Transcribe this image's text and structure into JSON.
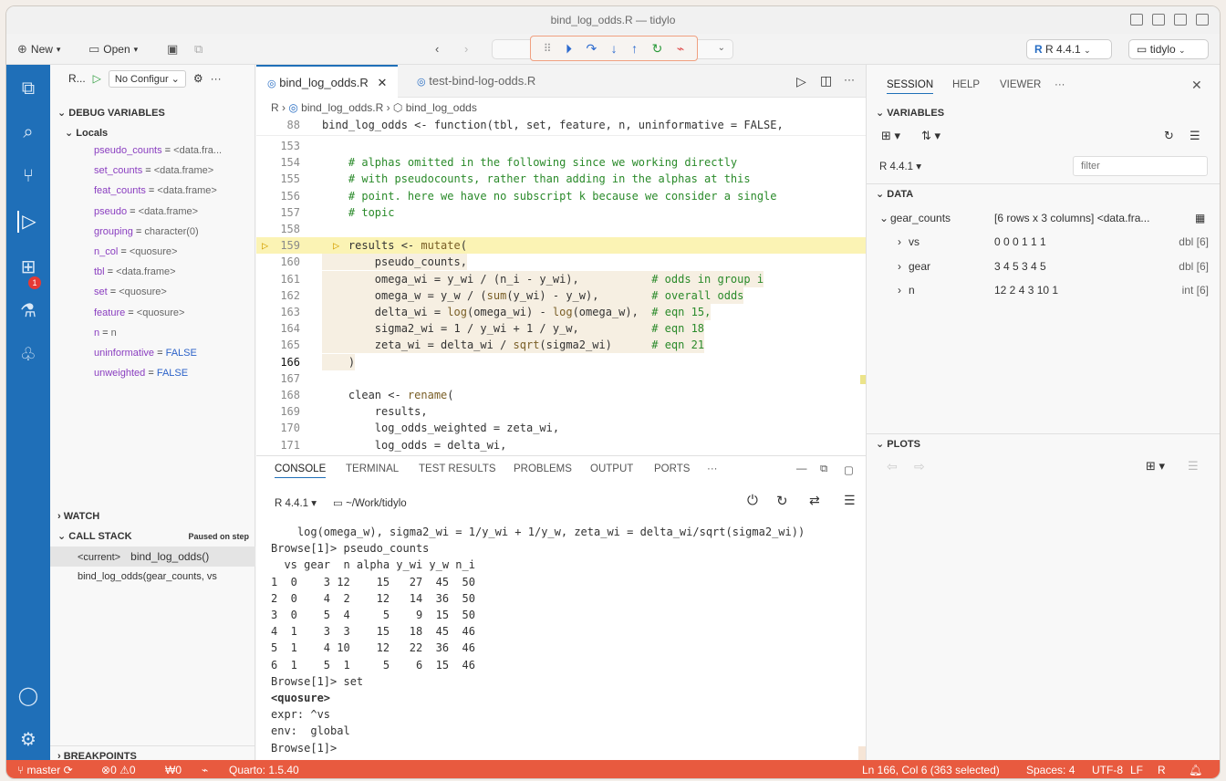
{
  "window_title": "bind_log_odds.R — tidylo",
  "toolbar": {
    "new_label": "New",
    "open_label": "Open",
    "r_version": "R 4.4.1",
    "project": "tidylo"
  },
  "sidebar": {
    "header_label": "R...",
    "config": "No Configur",
    "debug_variables_title": "DEBUG VARIABLES",
    "locals_title": "Locals",
    "variables": [
      {
        "name": "pseudo_counts",
        "value": "<data.fra..."
      },
      {
        "name": "set_counts",
        "value": "<data.frame>"
      },
      {
        "name": "feat_counts",
        "value": "<data.frame>"
      },
      {
        "name": "pseudo",
        "value": "<data.frame>"
      },
      {
        "name": "grouping",
        "value": "character(0)"
      },
      {
        "name": "n_col",
        "value": "<quosure>"
      },
      {
        "name": "tbl",
        "value": "<data.frame>"
      },
      {
        "name": "set",
        "value": "<quosure>"
      },
      {
        "name": "feature",
        "value": "<quosure>"
      },
      {
        "name": "n",
        "value": "n"
      },
      {
        "name": "uninformative",
        "value": "FALSE"
      },
      {
        "name": "unweighted",
        "value": "FALSE"
      }
    ],
    "watch_title": "WATCH",
    "callstack_title": "CALL STACK",
    "callstack_status": "Paused on step",
    "callstack_items": [
      {
        "left": "<current>",
        "right": "bind_log_odds()"
      },
      {
        "left": "bind_log_odds(gear_counts, vs",
        "right": ""
      }
    ],
    "breakpoints_title": "BREAKPOINTS"
  },
  "editor": {
    "tabs": [
      "bind_log_odds.R",
      "test-bind-log-odds.R"
    ],
    "breadcrumb": [
      "R",
      "bind_log_odds.R",
      "bind_log_odds"
    ],
    "sticky_line_no": "88",
    "sticky_code": "bind_log_odds <- function(tbl, set, feature, n, uninformative = FALSE,",
    "lines": [
      {
        "no": "153",
        "code": ""
      },
      {
        "no": "154",
        "code": "    # alphas omitted in the following since we working directly"
      },
      {
        "no": "155",
        "code": "    # with pseudocounts, rather than adding in the alphas at this"
      },
      {
        "no": "156",
        "code": "    # point. here we have no subscript k because we consider a single"
      },
      {
        "no": "157",
        "code": "    # topic"
      },
      {
        "no": "158",
        "code": ""
      },
      {
        "no": "159",
        "code": "    results <- mutate("
      },
      {
        "no": "160",
        "code": "        pseudo_counts,"
      },
      {
        "no": "161",
        "code": "        omega_wi = y_wi / (n_i - y_wi),           # odds in group i"
      },
      {
        "no": "162",
        "code": "        omega_w = y_w / (sum(y_wi) - y_w),        # overall odds"
      },
      {
        "no": "163",
        "code": "        delta_wi = log(omega_wi) - log(omega_w),  # eqn 15,"
      },
      {
        "no": "164",
        "code": "        sigma2_wi = 1 / y_wi + 1 / y_w,           # eqn 18"
      },
      {
        "no": "165",
        "code": "        zeta_wi = delta_wi / sqrt(sigma2_wi)      # eqn 21"
      },
      {
        "no": "166",
        "code": "    )"
      },
      {
        "no": "167",
        "code": ""
      },
      {
        "no": "168",
        "code": "    clean <- rename("
      },
      {
        "no": "169",
        "code": "        results,"
      },
      {
        "no": "170",
        "code": "        log_odds_weighted = zeta_wi,"
      },
      {
        "no": "171",
        "code": "        log_odds = delta_wi,"
      }
    ]
  },
  "panel": {
    "tabs": [
      "CONSOLE",
      "TERMINAL",
      "TEST RESULTS",
      "PROBLEMS",
      "OUTPUT",
      "PORTS"
    ],
    "r_version": "R 4.4.1",
    "path": "~/Work/tidylo",
    "console": [
      "    log(omega_w), sigma2_wi = 1/y_wi + 1/y_w, zeta_wi = delta_wi/sqrt(sigma2_wi))",
      "Browse[1]> pseudo_counts",
      "  vs gear  n alpha y_wi y_w n_i",
      "1  0    3 12    15   27  45  50",
      "2  0    4  2    12   14  36  50",
      "3  0    5  4     5    9  15  50",
      "4  1    3  3    15   18  45  46",
      "5  1    4 10    12   22  36  46",
      "6  1    5  1     5    6  15  46",
      "Browse[1]> set",
      "<quosure>",
      "expr: ^vs",
      "env:  global",
      "Browse[1]>"
    ]
  },
  "right": {
    "tabs": [
      "SESSION",
      "HELP",
      "VIEWER"
    ],
    "variables_title": "VARIABLES",
    "r_version": "R 4.4.1",
    "filter_placeholder": "filter",
    "data_title": "DATA",
    "dataset": {
      "name": "gear_counts",
      "summary": "[6 rows x 3 columns] <data.fra..."
    },
    "columns": [
      {
        "name": "vs",
        "values": "0 0 0 1 1 1",
        "type": "dbl [6]"
      },
      {
        "name": "gear",
        "values": "3 4 5 3 4 5",
        "type": "dbl [6]"
      },
      {
        "name": "n",
        "values": "12 2 4 3 10 1",
        "type": "int [6]"
      }
    ],
    "plots_title": "PLOTS"
  },
  "status": {
    "branch": "master",
    "errors": "0",
    "warnings": "0",
    "info": "0",
    "quarto": "Quarto: 1.5.40",
    "position": "Ln 166, Col 6 (363 selected)",
    "spaces": "Spaces: 4",
    "encoding": "UTF-8",
    "eol": "LF",
    "language": "R"
  }
}
